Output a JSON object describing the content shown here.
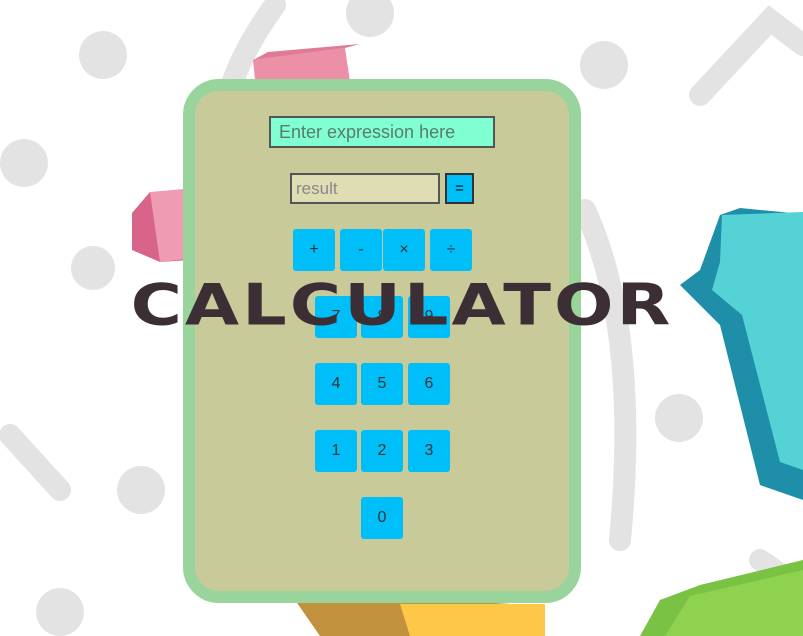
{
  "app": {
    "title": "CALCULATOR",
    "colors": {
      "panel": "#c8ca99",
      "panel_border": "#98d49b",
      "input": "#80ffd2",
      "result": "#deddb4",
      "key": "#00bef8",
      "title": "#3b2f35"
    }
  },
  "expression": {
    "value": "",
    "placeholder": "Enter expression here"
  },
  "result": {
    "value": "",
    "placeholder": "result"
  },
  "equals_label": "=",
  "operators": {
    "add": "+",
    "subtract": "-",
    "multiply": "×",
    "divide": "÷"
  },
  "digits": {
    "d0": "0",
    "d1": "1",
    "d2": "2",
    "d3": "3",
    "d4": "4",
    "d5": "5",
    "d6": "6",
    "d7": "7",
    "d8": "8",
    "d9": "9"
  }
}
